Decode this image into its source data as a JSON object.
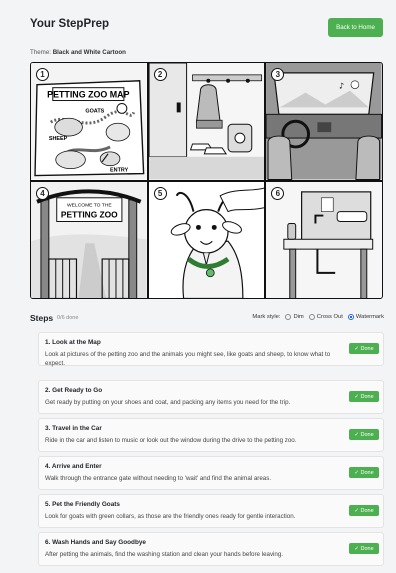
{
  "header": {
    "title": "Your StepPrep",
    "back_label": "Back to Home"
  },
  "theme": {
    "label": "Theme:",
    "value": "Black and White Cartoon"
  },
  "panels": [
    {
      "number": "1",
      "sign_title": "PETTING ZOO MAP",
      "goats": "GOATS",
      "sheep": "SHEEP",
      "entry": "ENTRY"
    },
    {
      "number": "2"
    },
    {
      "number": "3"
    },
    {
      "number": "4",
      "sign_top": "WELCOME TO THE",
      "sign_main": "PETTING ZOO"
    },
    {
      "number": "5"
    },
    {
      "number": "6"
    }
  ],
  "steps_header": {
    "title": "Steps",
    "count": "0/6 done",
    "mark_label": "Mark style:",
    "options": [
      "Dim",
      "Cross Out",
      "Watermark"
    ],
    "selected": "Watermark"
  },
  "done_label": "✓ Done",
  "steps": [
    {
      "title": "1. Look at the Map",
      "text": "Look at pictures of the petting zoo and the animals you might see, like goats and sheep, to know what to expect."
    },
    {
      "title": "2. Get Ready to Go",
      "text": "Get ready by putting on your shoes and coat, and packing any items you need for the trip."
    },
    {
      "title": "3. Travel in the Car",
      "text": "Ride in the car and listen to music or look out the window during the drive to the petting zoo."
    },
    {
      "title": "4. Arrive and Enter",
      "text": "Walk through the entrance gate without needing to 'wait' and find the animal areas."
    },
    {
      "title": "5. Pet the Friendly Goats",
      "text": "Look for goats with green collars, as those are the friendly ones ready for gentle interaction."
    },
    {
      "title": "6. Wash Hands and Say Goodbye",
      "text": "After petting the animals, find the washing station and clean your hands before leaving."
    }
  ],
  "colors": {
    "accent": "#4caf50",
    "radio_selected": "#2563eb"
  }
}
